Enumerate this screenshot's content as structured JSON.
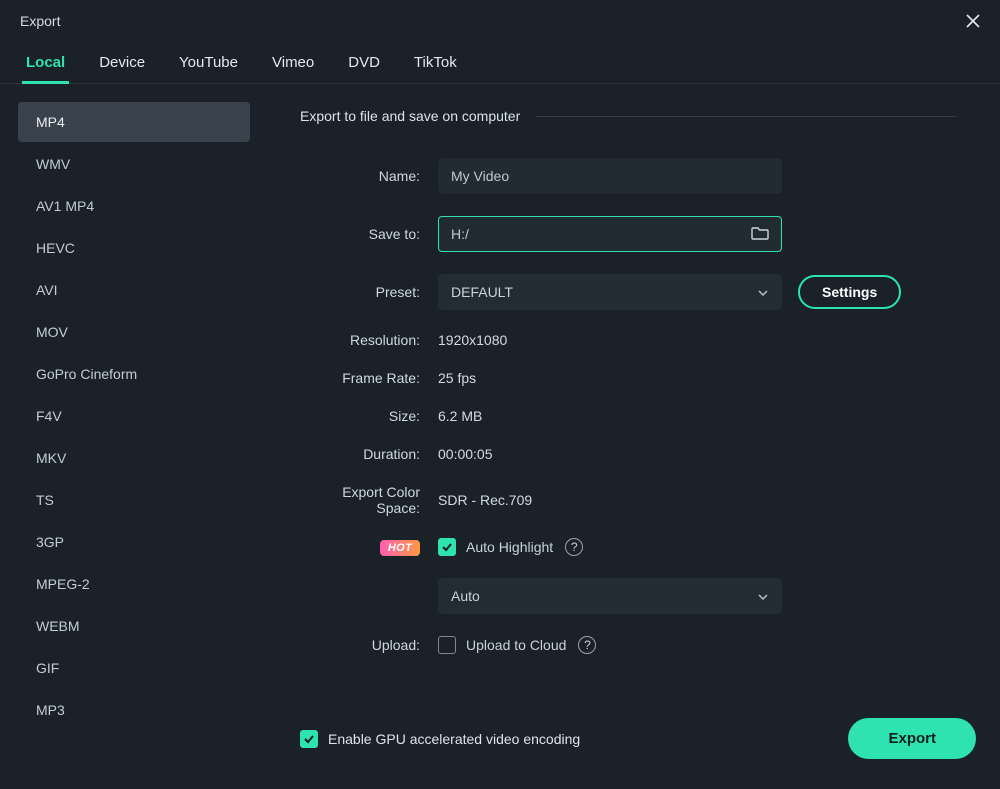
{
  "window": {
    "title": "Export"
  },
  "tabs": [
    {
      "label": "Local",
      "active": true
    },
    {
      "label": "Device"
    },
    {
      "label": "YouTube"
    },
    {
      "label": "Vimeo"
    },
    {
      "label": "DVD"
    },
    {
      "label": "TikTok"
    }
  ],
  "formats": [
    {
      "label": "MP4",
      "selected": true
    },
    {
      "label": "WMV"
    },
    {
      "label": "AV1 MP4"
    },
    {
      "label": "HEVC"
    },
    {
      "label": "AVI"
    },
    {
      "label": "MOV"
    },
    {
      "label": "GoPro Cineform"
    },
    {
      "label": "F4V"
    },
    {
      "label": "MKV"
    },
    {
      "label": "TS"
    },
    {
      "label": "3GP"
    },
    {
      "label": "MPEG-2"
    },
    {
      "label": "WEBM"
    },
    {
      "label": "GIF"
    },
    {
      "label": "MP3"
    }
  ],
  "section_title": "Export to file and save on computer",
  "labels": {
    "name": "Name:",
    "save_to": "Save to:",
    "preset": "Preset:",
    "resolution": "Resolution:",
    "frame_rate": "Frame Rate:",
    "size": "Size:",
    "duration": "Duration:",
    "color_space": "Export Color Space:",
    "upload": "Upload:"
  },
  "values": {
    "name": "My Video",
    "save_to": "H:/",
    "preset": "DEFAULT",
    "resolution": "1920x1080",
    "frame_rate": "25 fps",
    "size": "6.2 MB",
    "duration": "00:00:05",
    "color_space": "SDR - Rec.709",
    "auto_highlight_mode": "Auto"
  },
  "buttons": {
    "settings": "Settings",
    "export": "Export"
  },
  "badges": {
    "hot": "HOT"
  },
  "checks": {
    "auto_highlight": "Auto Highlight",
    "upload_cloud": "Upload to Cloud",
    "gpu": "Enable GPU accelerated video encoding"
  }
}
